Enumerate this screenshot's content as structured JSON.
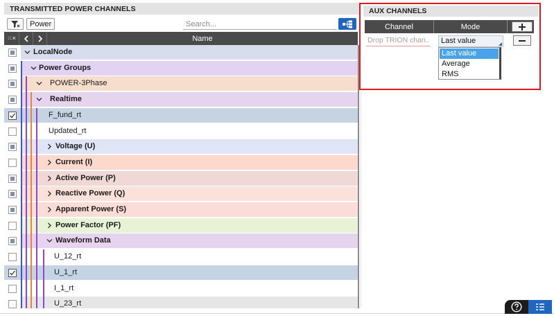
{
  "left_panel": {
    "title": "TRANSMITTED POWER CHANNELS",
    "power_button": "Power",
    "search_placeholder": "Search...",
    "column_name": "Name",
    "column_toggle": "⁙×",
    "rows": [
      {
        "label": "LocalNode",
        "bold": true,
        "expanded": true,
        "check": "partial",
        "color": "#d7dded"
      },
      {
        "label": "Power Groups",
        "bold": true,
        "expanded": true,
        "check": "partial",
        "color": "#e1d3f1"
      },
      {
        "label": "POWER-3Phase",
        "bold": false,
        "expanded": true,
        "check": "partial",
        "color": "#f7ddcc"
      },
      {
        "label": "Realtime",
        "bold": true,
        "expanded": true,
        "check": "partial",
        "color": "#e6d3ee"
      },
      {
        "label": "F_fund_rt",
        "bold": false,
        "expanded": null,
        "check": "checked",
        "color": "#c5d3e3"
      },
      {
        "label": "Updated_rt",
        "bold": false,
        "expanded": null,
        "check": "empty",
        "color": "#ffffff"
      },
      {
        "label": "Voltage (U)",
        "bold": true,
        "expanded": false,
        "check": "partial",
        "color": "#dfe5f5"
      },
      {
        "label": "Current (I)",
        "bold": true,
        "expanded": false,
        "check": "empty",
        "color": "#fdd8cc"
      },
      {
        "label": "Active Power (P)",
        "bold": true,
        "expanded": false,
        "check": "partial",
        "color": "#f0d8d6"
      },
      {
        "label": "Reactive Power (Q)",
        "bold": true,
        "expanded": false,
        "check": "partial",
        "color": "#fce0da"
      },
      {
        "label": "Apparent Power (S)",
        "bold": true,
        "expanded": false,
        "check": "partial",
        "color": "#fbdcd6"
      },
      {
        "label": "Power Factor (PF)",
        "bold": true,
        "expanded": false,
        "check": "empty",
        "color": "#e7f2d6"
      },
      {
        "label": "Waveform Data",
        "bold": true,
        "expanded": true,
        "check": "partial",
        "color": "#e6d3ee"
      },
      {
        "label": "U_12_rt",
        "bold": false,
        "expanded": null,
        "check": "empty",
        "color": "#ffffff"
      },
      {
        "label": "U_1_rt",
        "bold": false,
        "expanded": null,
        "check": "checked",
        "color": "#c5d3e3"
      },
      {
        "label": "I_1_rt",
        "bold": false,
        "expanded": null,
        "check": "empty",
        "color": "#ffffff"
      },
      {
        "label": "U_23_rt",
        "bold": false,
        "expanded": null,
        "check": "empty",
        "color": "#e6e6e6"
      }
    ]
  },
  "aux_panel": {
    "title": "AUX CHANNELS",
    "col_channel": "Channel",
    "col_mode": "Mode",
    "drop_placeholder": "Drop TRION chan...",
    "mode_value": "Last value",
    "mode_options": [
      "Last value",
      "Average",
      "RMS"
    ],
    "highlight_color": "#e3191f"
  },
  "icons": [
    "filter-icon",
    "chevron-left-icon",
    "chevron-right-icon",
    "tree-view-icon",
    "plus-icon",
    "minus-icon",
    "help-icon",
    "list-icon"
  ],
  "colors": {
    "accent": "#1f66c0",
    "header_bg": "#4a4a4a",
    "selection": "#4aa3e8"
  }
}
